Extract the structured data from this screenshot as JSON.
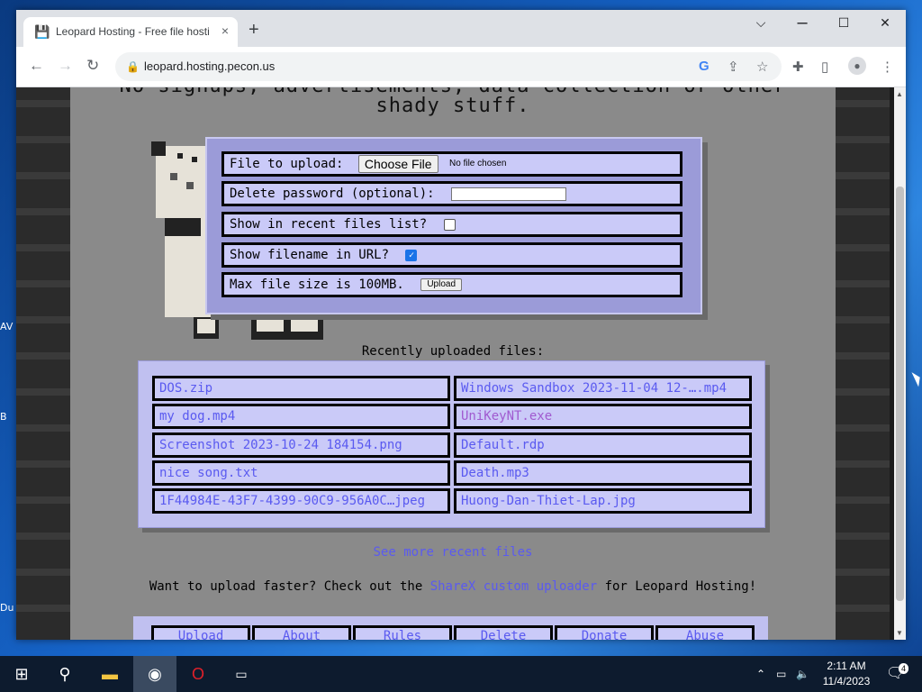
{
  "browser": {
    "tab_title": "Leopard Hosting - Free file hosting",
    "tab_close": "×",
    "new_tab": "+",
    "url": "leopard.hosting.pecon.us",
    "window_controls": {
      "minimize": "⌵",
      "maximize": "☐",
      "close": "✕"
    }
  },
  "desktop": {
    "fragments": [
      "AV",
      "B",
      "Du"
    ]
  },
  "page": {
    "headline_line1": "No signups, advertisements, data collection or other",
    "headline_line2": "shady stuff.",
    "upload_form": {
      "file_label": "File to upload:",
      "choose_button": "Choose File",
      "no_file": "No file chosen",
      "password_label": "Delete password (optional):",
      "password_value": "",
      "recent_label": "Show in recent files list?",
      "recent_checked": false,
      "filename_label": "Show filename in URL?",
      "filename_checked": true,
      "max_size_label": "Max file size is 100MB.",
      "upload_button": "Upload"
    },
    "recent_title": "Recently uploaded files:",
    "recent_files": [
      {
        "name": "DOS.zip",
        "visited": false
      },
      {
        "name": "Windows Sandbox 2023-11-04 12-….mp4",
        "visited": false
      },
      {
        "name": "my dog.mp4",
        "visited": false
      },
      {
        "name": "UniKeyNT.exe",
        "visited": true
      },
      {
        "name": "Screenshot 2023-10-24 184154.png",
        "visited": false
      },
      {
        "name": "Default.rdp",
        "visited": false
      },
      {
        "name": "nice song.txt",
        "visited": false
      },
      {
        "name": "Death.mp3",
        "visited": false
      },
      {
        "name": "1F44984E-43F7-4399-90C9-956A0C…jpeg",
        "visited": false
      },
      {
        "name": "Huong-Dan-Thiet-Lap.jpg",
        "visited": false
      }
    ],
    "see_more": "See more recent files",
    "faster_prefix": "Want to upload faster? Check out the",
    "faster_link": "ShareX custom uploader",
    "faster_suffix": "for Leopard Hosting!",
    "nav": [
      "Upload",
      "About",
      "Rules",
      "Delete",
      "Donate",
      "Abuse"
    ]
  },
  "taskbar": {
    "time": "2:11 AM",
    "date": "11/4/2023",
    "notifications": "4"
  },
  "colors": {
    "link": "#5a5af0",
    "visited_link": "#a05ad0",
    "panel": "#cacaf8",
    "page_bg": "#8a8a8a"
  }
}
